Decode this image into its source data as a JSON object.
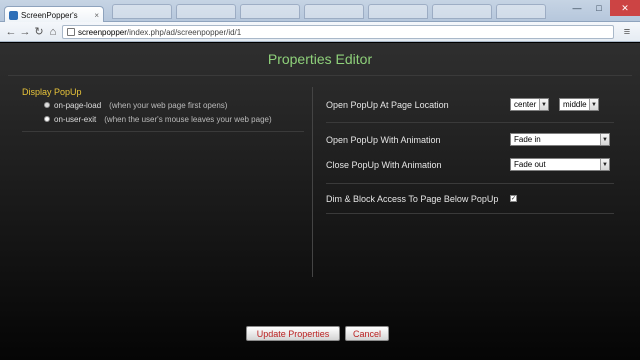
{
  "browser": {
    "active_tab": {
      "title": "ScreenPopper's",
      "close_glyph": "×"
    },
    "window_controls": {
      "minimize": "—",
      "maximize": "□",
      "close": "✕"
    },
    "nav": {
      "back": "←",
      "forward": "→",
      "reload": "↻",
      "home": "⌂",
      "menu": "≡"
    },
    "url": {
      "host": "screenpopper",
      "path": "/index.php/ad/screenpopper/id/1"
    }
  },
  "page": {
    "title": "Properties Editor",
    "display_popup": {
      "label": "Display PopUp",
      "options": [
        {
          "name": "on-page-load",
          "desc": "(when your web page first opens)",
          "checked": false
        },
        {
          "name": "on-user-exit",
          "desc": "(when the user's mouse leaves your web page)",
          "checked": true
        }
      ]
    },
    "location": {
      "label": "Open PopUp At Page Location",
      "horizontal": "center",
      "vertical": "middle"
    },
    "open_animation": {
      "label": "Open PopUp With Animation",
      "value": "Fade in"
    },
    "close_animation": {
      "label": "Close PopUp With Animation",
      "value": "Fade out"
    },
    "dim_block": {
      "label": "Dim & Block Access To Page Below PopUp",
      "checked": true,
      "check_glyph": "✓"
    },
    "buttons": {
      "update": "Update Properties",
      "cancel": "Cancel"
    },
    "select_arrow": "▼"
  },
  "colors": {
    "title": "#8ed07a",
    "section_label": "#e8c43a",
    "button_text": "#b22222"
  },
  "icons": [
    "favicon-icon",
    "back-icon",
    "forward-icon",
    "reload-icon",
    "home-icon",
    "page-icon",
    "wrench-icon"
  ]
}
